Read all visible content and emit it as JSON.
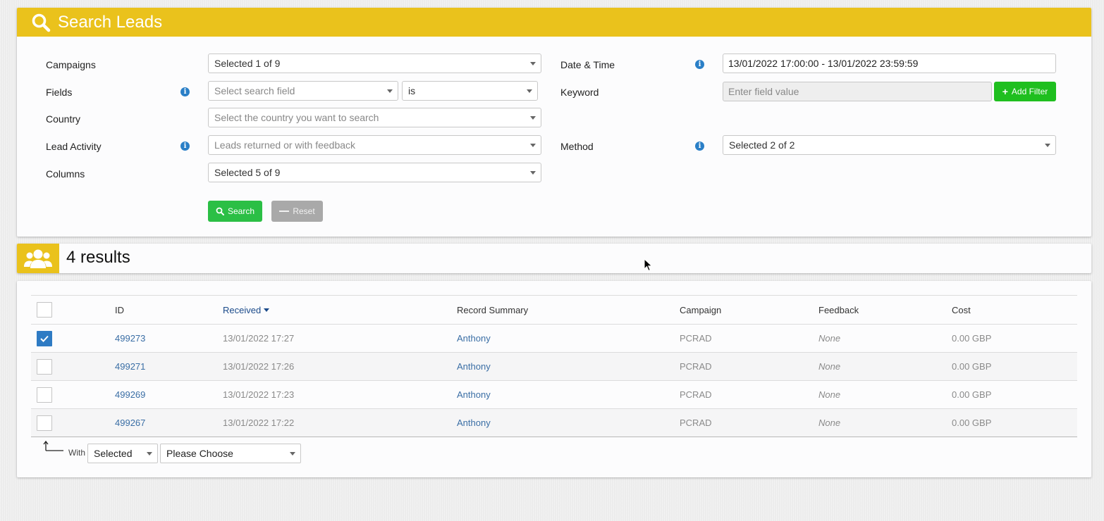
{
  "search": {
    "title": "Search Leads",
    "campaigns_label": "Campaigns",
    "campaigns_value": "Selected 1 of 9",
    "fields_label": "Fields",
    "fields_placeholder": "Select search field",
    "operator_value": "is",
    "country_label": "Country",
    "country_placeholder": "Select the country you want to search",
    "lead_activity_label": "Lead Activity",
    "lead_activity_placeholder": "Leads returned or with feedback",
    "columns_label": "Columns",
    "columns_value": "Selected 5 of 9",
    "datetime_label": "Date & Time",
    "datetime_value": "13/01/2022 17:00:00 - 13/01/2022 23:59:59",
    "keyword_label": "Keyword",
    "keyword_placeholder": "Enter field value",
    "add_filter_label": "Add Filter",
    "method_label": "Method",
    "method_value": "Selected 2 of 2",
    "search_button": "Search",
    "reset_button": "Reset"
  },
  "results": {
    "title": "4 results",
    "columns": [
      "ID",
      "Received",
      "Record Summary",
      "Campaign",
      "Feedback",
      "Cost"
    ],
    "rows": [
      {
        "checked": true,
        "id": "499273",
        "received": "13/01/2022 17:27",
        "summary": "Anthony",
        "campaign": "PCRAD",
        "feedback": "None",
        "cost": "0.00 GBP"
      },
      {
        "checked": false,
        "id": "499271",
        "received": "13/01/2022 17:26",
        "summary": "Anthony",
        "campaign": "PCRAD",
        "feedback": "None",
        "cost": "0.00 GBP"
      },
      {
        "checked": false,
        "id": "499269",
        "received": "13/01/2022 17:23",
        "summary": "Anthony",
        "campaign": "PCRAD",
        "feedback": "None",
        "cost": "0.00 GBP"
      },
      {
        "checked": false,
        "id": "499267",
        "received": "13/01/2022 17:22",
        "summary": "Anthony",
        "campaign": "PCRAD",
        "feedback": "None",
        "cost": "0.00 GBP"
      }
    ],
    "bulk_with_label": "With",
    "bulk_scope_value": "Selected",
    "bulk_action_placeholder": "Please Choose"
  },
  "colors": {
    "header_yellow": "#eac21c",
    "search_green": "#2bbf45",
    "checkbox_blue": "#2e7bc4",
    "link_blue": "#3a6ea5"
  },
  "icons": [
    "search-icon",
    "info-icon",
    "plus-icon",
    "minus-icon",
    "users-icon",
    "caret-down-icon",
    "checkmark-icon",
    "arrow-up-left-icon",
    "cursor-icon"
  ]
}
